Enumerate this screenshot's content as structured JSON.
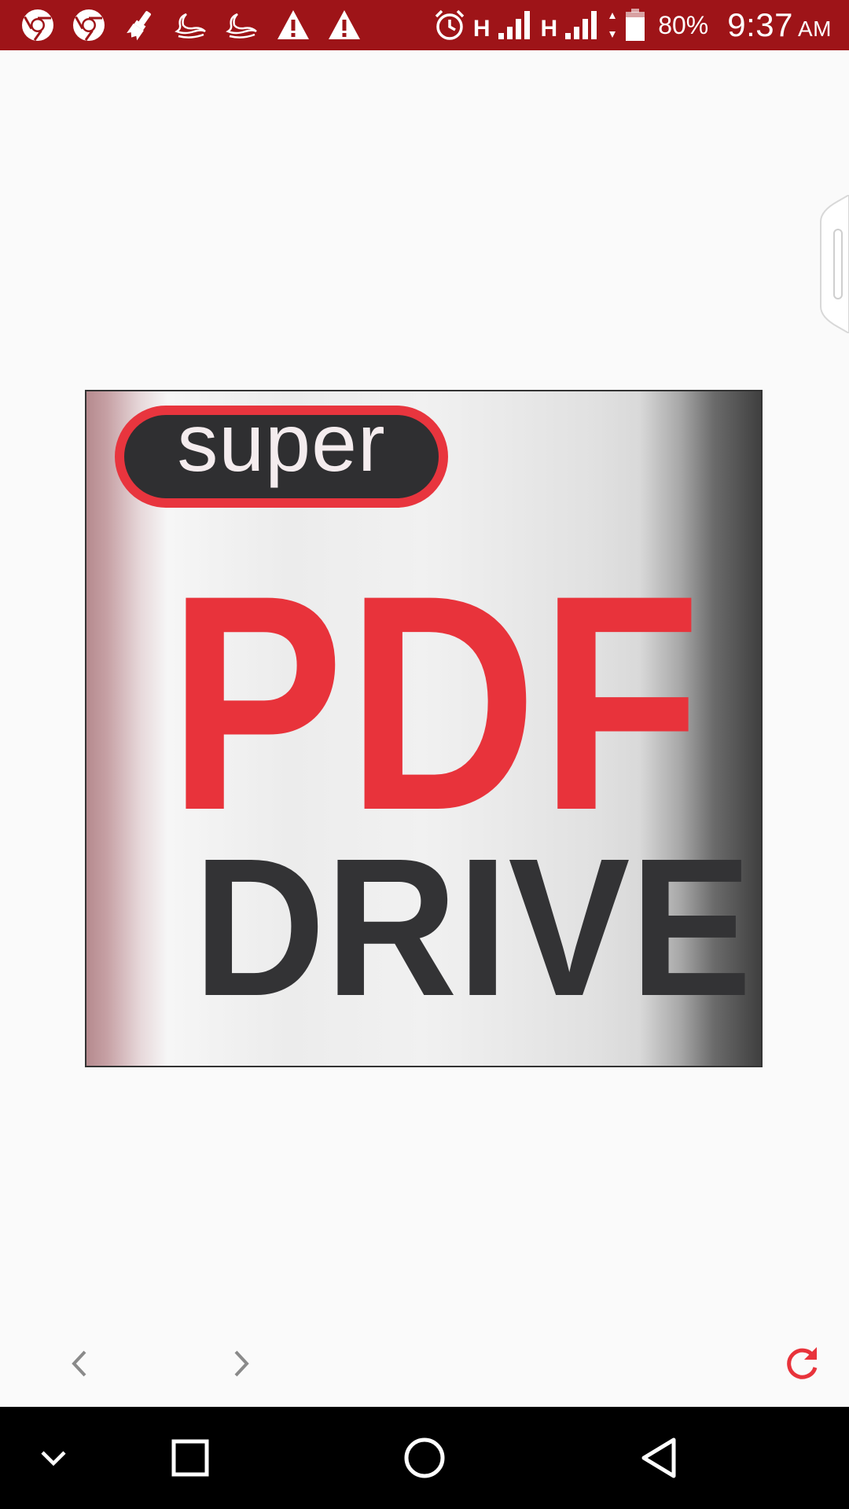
{
  "status_bar": {
    "notification_icons": [
      "chrome-icon",
      "chrome-icon",
      "paintbrush-icon",
      "bird-icon",
      "bird-icon",
      "warning-icon",
      "warning-icon"
    ],
    "alarm_icon": "alarm-icon",
    "network_type_1": "H",
    "network_type_2": "H",
    "battery_percent": "80%",
    "time": "9:37",
    "ampm": "AM"
  },
  "logo": {
    "badge_text": "super",
    "main_text": "PDF",
    "sub_text": "DRIVE"
  },
  "toolbar": {
    "back_icon": "chevron-left-icon",
    "forward_icon": "chevron-right-icon",
    "refresh_icon": "refresh-icon"
  },
  "nav_bar": {
    "collapse_icon": "chevron-down-icon",
    "recents_icon": "square-icon",
    "home_icon": "circle-icon",
    "back_icon": "triangle-back-icon"
  },
  "colors": {
    "status_bar": "#9e1418",
    "accent_red": "#e8333b",
    "text_dark": "#333335",
    "nav_bar": "#000000",
    "background": "#fafafa"
  }
}
